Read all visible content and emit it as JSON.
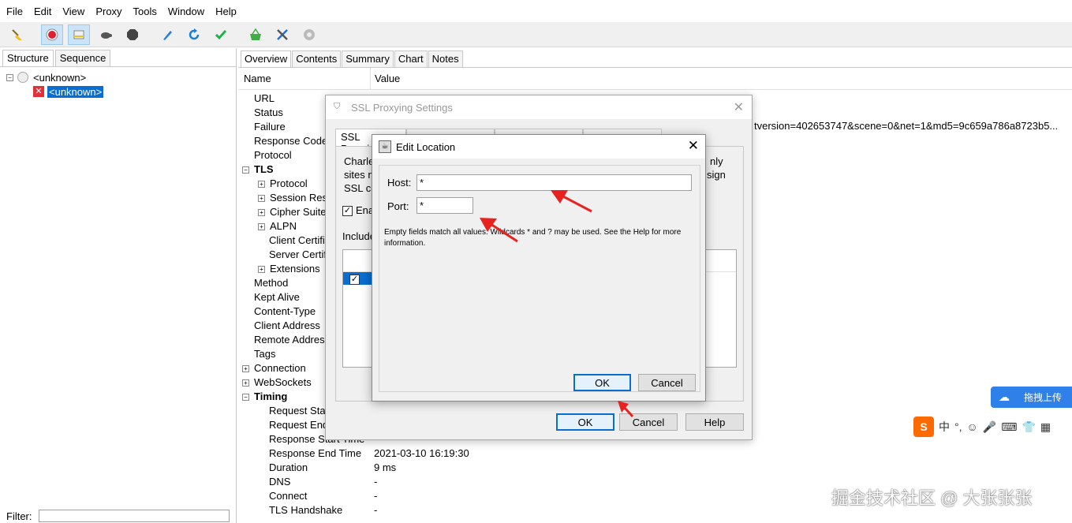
{
  "menu": [
    "File",
    "Edit",
    "View",
    "Proxy",
    "Tools",
    "Window",
    "Help"
  ],
  "left": {
    "tabs": [
      "Structure",
      "Sequence"
    ],
    "tree_root": "<unknown>",
    "tree_child": "<unknown>",
    "filter_label": "Filter:"
  },
  "right": {
    "tabs": [
      "Overview",
      "Contents",
      "Summary",
      "Chart",
      "Notes"
    ],
    "col_name": "Name",
    "col_value": "Value",
    "props": [
      {
        "label": "URL",
        "indent": 1
      },
      {
        "label": "Status",
        "indent": 1
      },
      {
        "label": "Failure",
        "indent": 1
      },
      {
        "label": "Response Code",
        "indent": 1
      },
      {
        "label": "Protocol",
        "indent": 1
      },
      {
        "label": "TLS",
        "indent": 0,
        "bold": true,
        "expander": "−"
      },
      {
        "label": "Protocol",
        "indent": 2,
        "expander": "+"
      },
      {
        "label": "Session Resumed",
        "indent": 2,
        "expander": "+"
      },
      {
        "label": "Cipher Suite",
        "indent": 2,
        "expander": "+"
      },
      {
        "label": "ALPN",
        "indent": 2,
        "expander": "+"
      },
      {
        "label": "Client Certificates",
        "indent": 3
      },
      {
        "label": "Server Certificates",
        "indent": 3
      },
      {
        "label": "Extensions",
        "indent": 2,
        "expander": "+"
      },
      {
        "label": "Method",
        "indent": 1
      },
      {
        "label": "Kept Alive",
        "indent": 1
      },
      {
        "label": "Content-Type",
        "indent": 1
      },
      {
        "label": "Client Address",
        "indent": 1
      },
      {
        "label": "Remote Address",
        "indent": 1
      },
      {
        "label": "Tags",
        "indent": 1
      },
      {
        "label": "Connection",
        "indent": 0,
        "expander": "+"
      },
      {
        "label": "WebSockets",
        "indent": 0,
        "expander": "+"
      },
      {
        "label": "Timing",
        "indent": 0,
        "bold": true,
        "expander": "−"
      },
      {
        "label": "Request Start Time",
        "indent": 3
      },
      {
        "label": "Request End Time",
        "indent": 3
      },
      {
        "label": "Response Start Time",
        "indent": 3
      },
      {
        "label": "Response End Time",
        "indent": 3
      },
      {
        "label": "Duration",
        "indent": 3
      },
      {
        "label": "DNS",
        "indent": 3
      },
      {
        "label": "Connect",
        "indent": 3
      },
      {
        "label": "TLS Handshake",
        "indent": 3
      }
    ],
    "url_value_tail": "tversion=402653747&scene=0&net=1&md5=9c659a786a8723b5...",
    "response_end_time": "2021-03-10 16:19:30",
    "duration": "9 ms",
    "dns": "-",
    "connect": "-",
    "tls_handshake": "-"
  },
  "ssl_dialog": {
    "title": "SSL Proxying Settings",
    "tab_first": "SSL Proxying",
    "text_line1": "Charles",
    "text_line1_right": "nly",
    "text_line2": "sites n",
    "text_line2_right": "sign",
    "text_line3": "SSL ce",
    "enable_label": "Ena",
    "include_label": "Include",
    "ok": "OK",
    "cancel": "Cancel",
    "help": "Help"
  },
  "edit_dialog": {
    "title": "Edit Location",
    "host_label": "Host:",
    "host_value": "*",
    "port_label": "Port:",
    "port_value": "*",
    "help_text": "Empty fields match all values. Wildcards * and ? may be used. See the Help for more information.",
    "ok": "OK",
    "cancel": "Cancel"
  },
  "widgets": {
    "upload_label": "拖拽上传",
    "ime_items": [
      "中",
      "°,",
      "☺",
      "🎤",
      "⌨",
      "👕",
      "▦"
    ],
    "watermark": "掘金技术社区 @ 大张张张"
  },
  "colors": {
    "selection": "#0a6ed1",
    "arrow": "#e8231f",
    "upload_bg": "#2f80e8",
    "ime_logo": "#ff6a00"
  }
}
